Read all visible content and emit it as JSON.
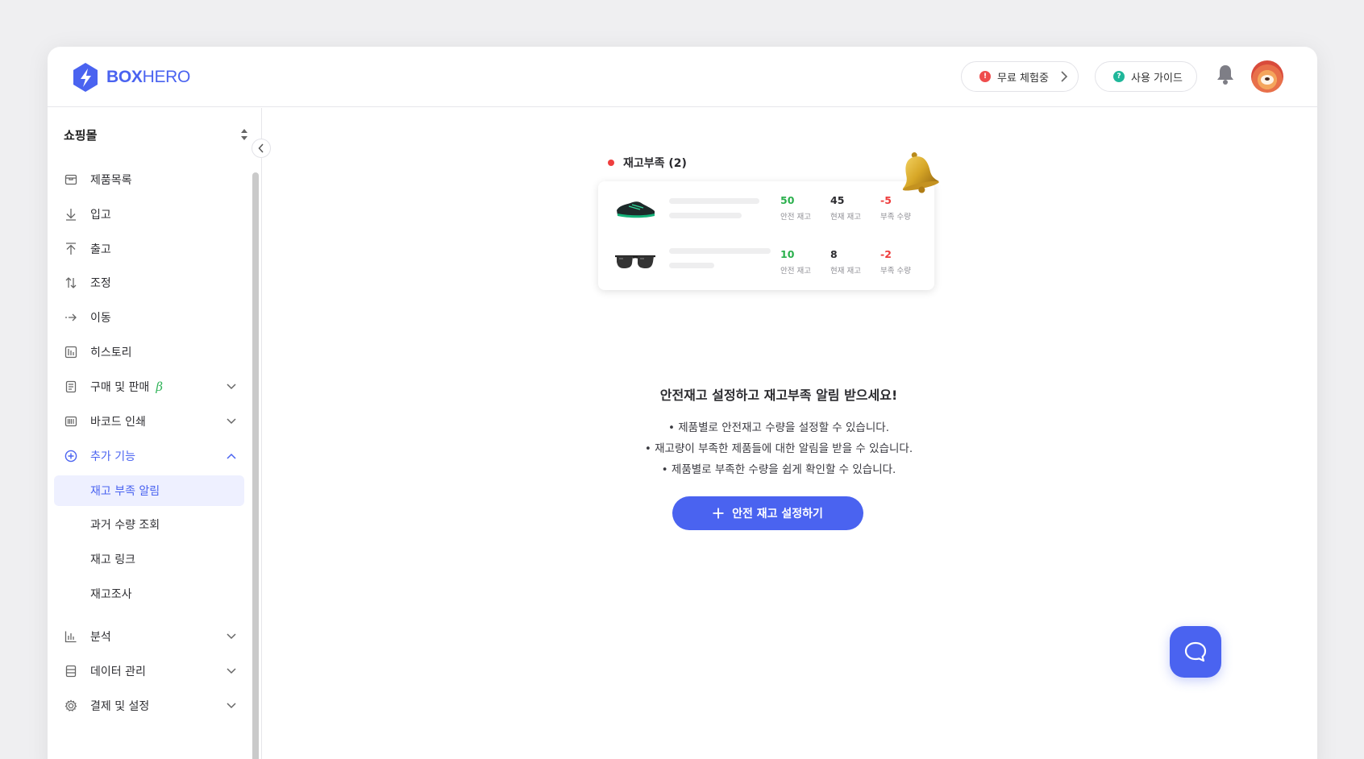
{
  "brand": {
    "logo_bold": "BOX",
    "logo_light": "HERO"
  },
  "header": {
    "trial_label": "무료 체험중",
    "guide_label": "사용 가이드"
  },
  "sidebar": {
    "store_name": "쇼핑몰",
    "items": [
      {
        "label": "제품목록",
        "icon": "box-icon"
      },
      {
        "label": "입고",
        "icon": "arrow-down-icon"
      },
      {
        "label": "출고",
        "icon": "arrow-up-icon"
      },
      {
        "label": "조정",
        "icon": "swap-vertical-icon"
      },
      {
        "label": "이동",
        "icon": "arrow-right-icon"
      },
      {
        "label": "히스토리",
        "icon": "history-icon"
      },
      {
        "label": "구매 및 판매",
        "icon": "document-icon",
        "badge": "β"
      },
      {
        "label": "바코드 인쇄",
        "icon": "barcode-icon"
      },
      {
        "label": "추가 기능",
        "icon": "plus-circle-icon"
      },
      {
        "label": "재고 부족 알림"
      },
      {
        "label": "과거 수량 조회"
      },
      {
        "label": "재고 링크"
      },
      {
        "label": "재고조사"
      },
      {
        "label": "분석",
        "icon": "chart-icon"
      },
      {
        "label": "데이터 관리",
        "icon": "database-icon"
      },
      {
        "label": "결제 및 설정",
        "icon": "gear-icon"
      }
    ]
  },
  "preview": {
    "title": "재고부족 (2)",
    "rows": [
      {
        "product": "sneaker",
        "safe": "50",
        "safe_label": "안전 재고",
        "current": "45",
        "current_label": "현재 재고",
        "short": "-5",
        "short_label": "부족 수량"
      },
      {
        "product": "sunglasses",
        "safe": "10",
        "safe_label": "안전 재고",
        "current": "8",
        "current_label": "현재 재고",
        "short": "-2",
        "short_label": "부족 수량"
      }
    ]
  },
  "main": {
    "headline": "안전재고 설정하고 재고부족 알림 받으세요!",
    "bullets": [
      "• 제품별로 안전재고 수량을 설정할 수 있습니다.",
      "• 재고량이 부족한 제품들에 대한 알림을 받을 수 있습니다.",
      "• 제품별로 부족한 수량을 쉽게 확인할 수 있습니다."
    ],
    "cta_label": "안전 재고 설정하기"
  },
  "colors": {
    "accent": "#4a63f0",
    "active_bg": "#eef0ff",
    "safe": "#2bb04d",
    "shortage": "#ee3b3b"
  }
}
